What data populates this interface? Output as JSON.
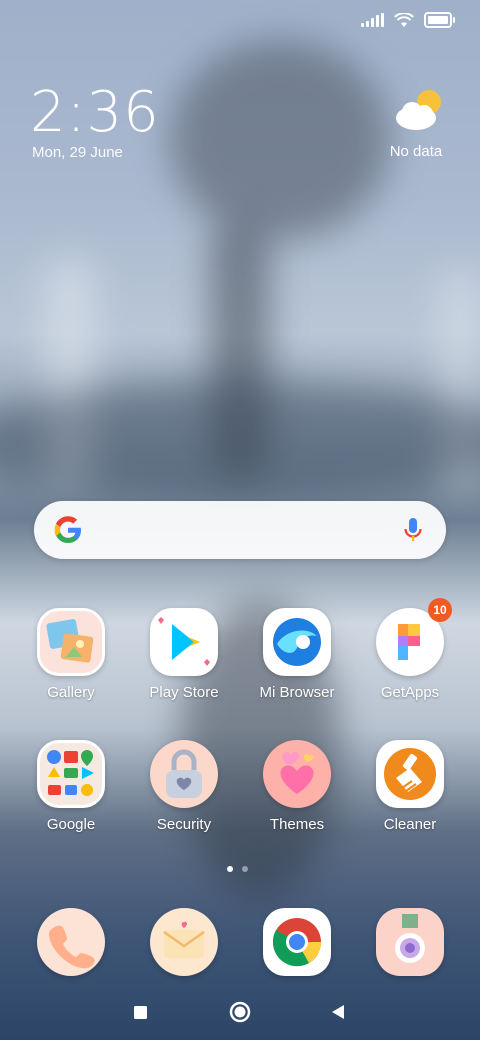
{
  "status_bar": {
    "signal": "signal-icon",
    "wifi": "wifi-icon",
    "battery": "battery-full-icon"
  },
  "clock": {
    "time": "2:36",
    "date": "Mon, 29 June"
  },
  "weather": {
    "icon": "partly-cloudy-icon",
    "text": "No data"
  },
  "search": {
    "google_icon": "google-g-icon",
    "mic_icon": "mic-icon"
  },
  "apps_row1": [
    {
      "label": "Gallery",
      "icon": "gallery-icon"
    },
    {
      "label": "Play Store",
      "icon": "play-store-icon"
    },
    {
      "label": "Mi Browser",
      "icon": "mi-browser-icon"
    },
    {
      "label": "GetApps",
      "icon": "getapps-icon",
      "badge": "10"
    }
  ],
  "apps_row2": [
    {
      "label": "Google",
      "icon": "google-folder-icon"
    },
    {
      "label": "Security",
      "icon": "security-icon"
    },
    {
      "label": "Themes",
      "icon": "themes-icon"
    },
    {
      "label": "Cleaner",
      "icon": "cleaner-icon"
    }
  ],
  "dock": [
    {
      "icon": "phone-icon"
    },
    {
      "icon": "messages-icon"
    },
    {
      "icon": "chrome-icon"
    },
    {
      "icon": "camera-icon"
    }
  ],
  "page_indicator": {
    "pages": 2,
    "current": 1
  },
  "nav": {
    "recents": "recents-icon",
    "home": "home-icon",
    "back": "back-icon"
  }
}
